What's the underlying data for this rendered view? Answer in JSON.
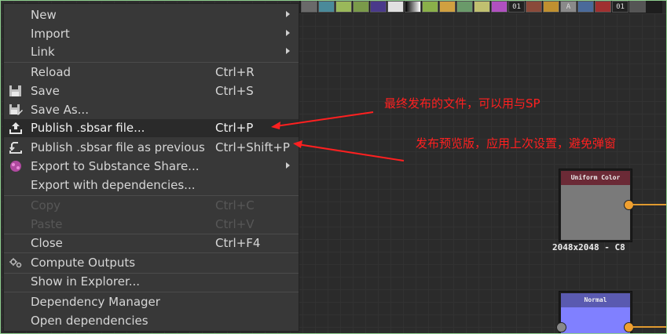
{
  "menu": {
    "items": [
      {
        "label": "New",
        "submenu": true
      },
      {
        "label": "Import",
        "submenu": true
      },
      {
        "label": "Link",
        "submenu": true
      },
      {
        "label": "Reload",
        "shortcut": "Ctrl+R"
      },
      {
        "label": "Save",
        "shortcut": "Ctrl+S",
        "icon": "save-icon"
      },
      {
        "label": "Save As...",
        "icon": "save-as-icon"
      },
      {
        "label": "Publish .sbsar file...",
        "shortcut": "Ctrl+P",
        "icon": "publish-icon",
        "highlighted": true
      },
      {
        "label": "Publish .sbsar file as previous",
        "shortcut": "Ctrl+Shift+P",
        "icon": "publish-previous-icon"
      },
      {
        "label": "Export to Substance Share...",
        "submenu": true,
        "icon": "substance-share-icon"
      },
      {
        "label": "Export with dependencies..."
      },
      {
        "label": "Copy",
        "shortcut": "Ctrl+C",
        "disabled": true
      },
      {
        "label": "Paste",
        "shortcut": "Ctrl+V",
        "disabled": true
      },
      {
        "label": "Close",
        "shortcut": "Ctrl+F4"
      },
      {
        "label": "Compute Outputs",
        "icon": "compute-icon"
      },
      {
        "label": "Show in Explorer..."
      },
      {
        "label": "Dependency Manager"
      },
      {
        "label": "Open dependencies"
      }
    ]
  },
  "annotations": {
    "publish_note": "最终发布的文件，可以用与SP",
    "publish_previous_note": "发布预览版，应用上次设置，避免弹窗"
  },
  "toolbar": {
    "text_a": "01",
    "text_b": "A",
    "text_c": "01"
  },
  "nodes": {
    "uniform_color": {
      "title": "Uniform Color",
      "resolution": "2048x2048 - C8",
      "header_color": "#6b2a36",
      "body_color": "#7a7a7a"
    },
    "normal": {
      "title": "Normal",
      "header_color": "#5a5ab0",
      "body_color": "#8080ff"
    }
  },
  "colors": {
    "accent_red": "#ff2020",
    "port": "#f0a030"
  }
}
